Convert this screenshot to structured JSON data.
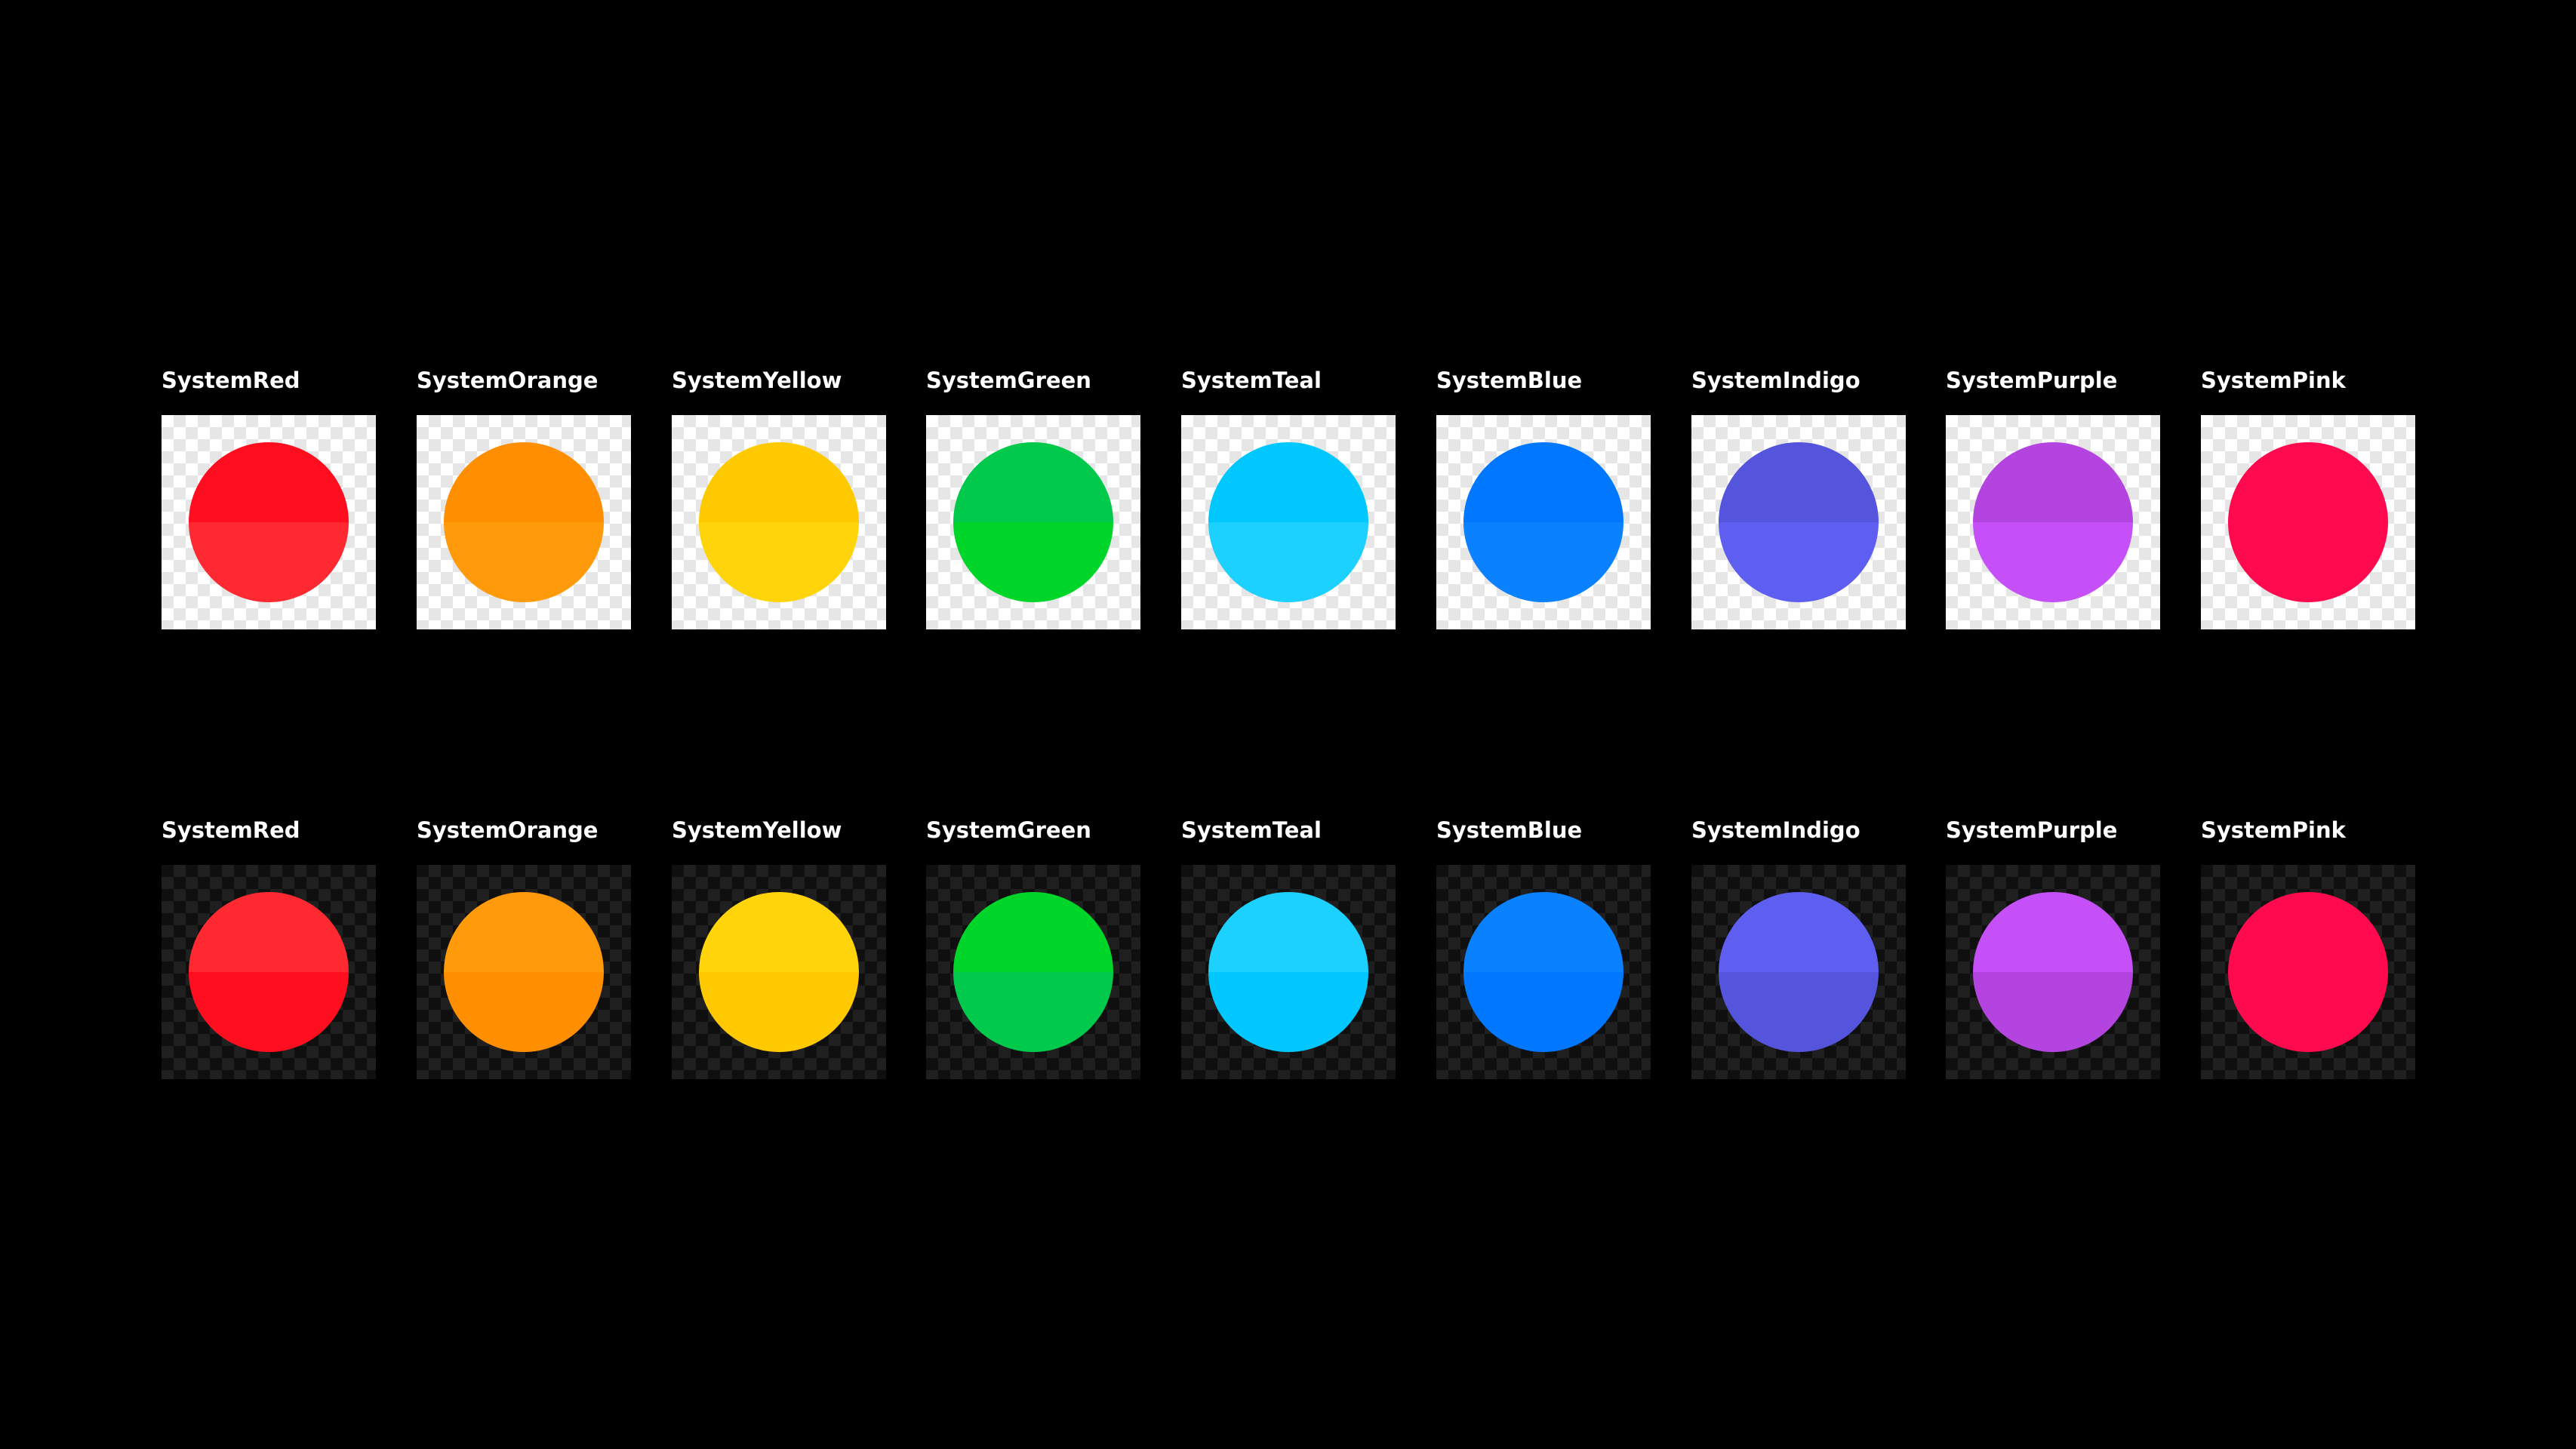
{
  "rows": [
    {
      "mode": "light",
      "swatches": [
        {
          "label": "SystemRed",
          "top": "#ff0e1f",
          "bottom": "#ff2a31"
        },
        {
          "label": "SystemOrange",
          "top": "#ff8e00",
          "bottom": "#ff9a0b"
        },
        {
          "label": "SystemYellow",
          "top": "#ffc900",
          "bottom": "#ffd40a"
        },
        {
          "label": "SystemGreen",
          "top": "#00c94b",
          "bottom": "#00d629"
        },
        {
          "label": "SystemTeal",
          "top": "#00c8ff",
          "bottom": "#1cd0ff"
        },
        {
          "label": "SystemBlue",
          "top": "#0077ff",
          "bottom": "#0a82ff"
        },
        {
          "label": "SystemIndigo",
          "top": "#5454dc",
          "bottom": "#5e5ef0"
        },
        {
          "label": "SystemPurple",
          "top": "#b444e0",
          "bottom": "#c650f7"
        },
        {
          "label": "SystemPink",
          "top": "#ff0a4e",
          "bottom": "#ff0a4e"
        }
      ]
    },
    {
      "mode": "dark",
      "swatches": [
        {
          "label": "SystemRed",
          "top": "#ff2a31",
          "bottom": "#ff0e1f"
        },
        {
          "label": "SystemOrange",
          "top": "#ff9a0b",
          "bottom": "#ff8e00"
        },
        {
          "label": "SystemYellow",
          "top": "#ffd40a",
          "bottom": "#ffc900"
        },
        {
          "label": "SystemGreen",
          "top": "#00d629",
          "bottom": "#00c94b"
        },
        {
          "label": "SystemTeal",
          "top": "#1cd0ff",
          "bottom": "#00c8ff"
        },
        {
          "label": "SystemBlue",
          "top": "#0a82ff",
          "bottom": "#0077ff"
        },
        {
          "label": "SystemIndigo",
          "top": "#5e5ef0",
          "bottom": "#5454dc"
        },
        {
          "label": "SystemPurple",
          "top": "#c650f7",
          "bottom": "#b444e0"
        },
        {
          "label": "SystemPink",
          "top": "#ff0a4e",
          "bottom": "#ff0a4e"
        }
      ]
    }
  ]
}
